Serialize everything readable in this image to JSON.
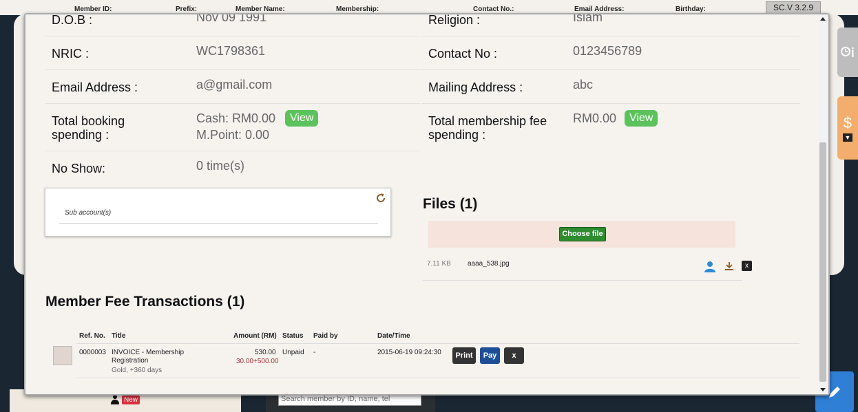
{
  "background": {
    "table_headers": [
      "Member ID:",
      "Prefix:",
      "Member Name:",
      "Membership:",
      "Contact No.:",
      "Email Address:",
      "Birthday:"
    ],
    "version": "SC.V 3.2.9",
    "new_badge": "New",
    "search_placeholder": "Search member by ID, name, tel"
  },
  "member": {
    "dob_label": "D.O.B :",
    "dob_value": "Nov 09 1991",
    "religion_label": "Religion :",
    "religion_value": "Islam",
    "nric_label": "NRIC :",
    "nric_value": "WC1798361",
    "contact_label": "Contact No :",
    "contact_value": "0123456789",
    "email_label": "Email Address :",
    "email_value": "a@gmail.com",
    "mailing_label": "Mailing Address :",
    "mailing_value": "abc",
    "booking_label_1": "Total booking",
    "booking_label_2": "spending :",
    "booking_cash": "Cash: RM0.00",
    "booking_point": "M.Point: 0.00",
    "membership_label_1": "Total membership fee",
    "membership_label_2": "spending :",
    "membership_value": "RM0.00",
    "view_label": "View",
    "noshow_label": "No Show:",
    "noshow_value": "0 time(s)"
  },
  "sub_accounts": {
    "title": "Sub account(s)"
  },
  "files": {
    "title": "Files (1)",
    "choose_label": "Choose file",
    "items": [
      {
        "size": "7.11 KB",
        "name": "aaaa_538.jpg"
      }
    ]
  },
  "transactions": {
    "title": "Member Fee Transactions (1)",
    "columns": [
      "Ref. No.",
      "Title",
      "Amount (RM)",
      "Status",
      "Paid by",
      "Date/Time"
    ],
    "rows": [
      {
        "ref": "0000003",
        "title_1": "INVOICE - Membership",
        "title_2": "Registration",
        "title_3": "Gold, +360 days",
        "amount": "530.00",
        "amount_breakdown": "30.00+500.00",
        "status": "Unpaid",
        "paid_by": "-",
        "datetime": "2015-06-19 09:24:30",
        "print_label": "Print",
        "pay_label": "Pay",
        "delete_label": "x"
      }
    ]
  },
  "colors": {
    "view_button": "#5cc25c",
    "choose_button": "#2e8b2e",
    "pay_button": "#1f4e99",
    "print_button": "#333333",
    "side_tab_fee": "#f3ad6c",
    "edit_fab": "#2f7fd6"
  },
  "icons": [
    "refresh-icon",
    "user-icon",
    "download-icon",
    "close-icon",
    "clock-info-icon",
    "dollar-icon",
    "edit-icon"
  ]
}
